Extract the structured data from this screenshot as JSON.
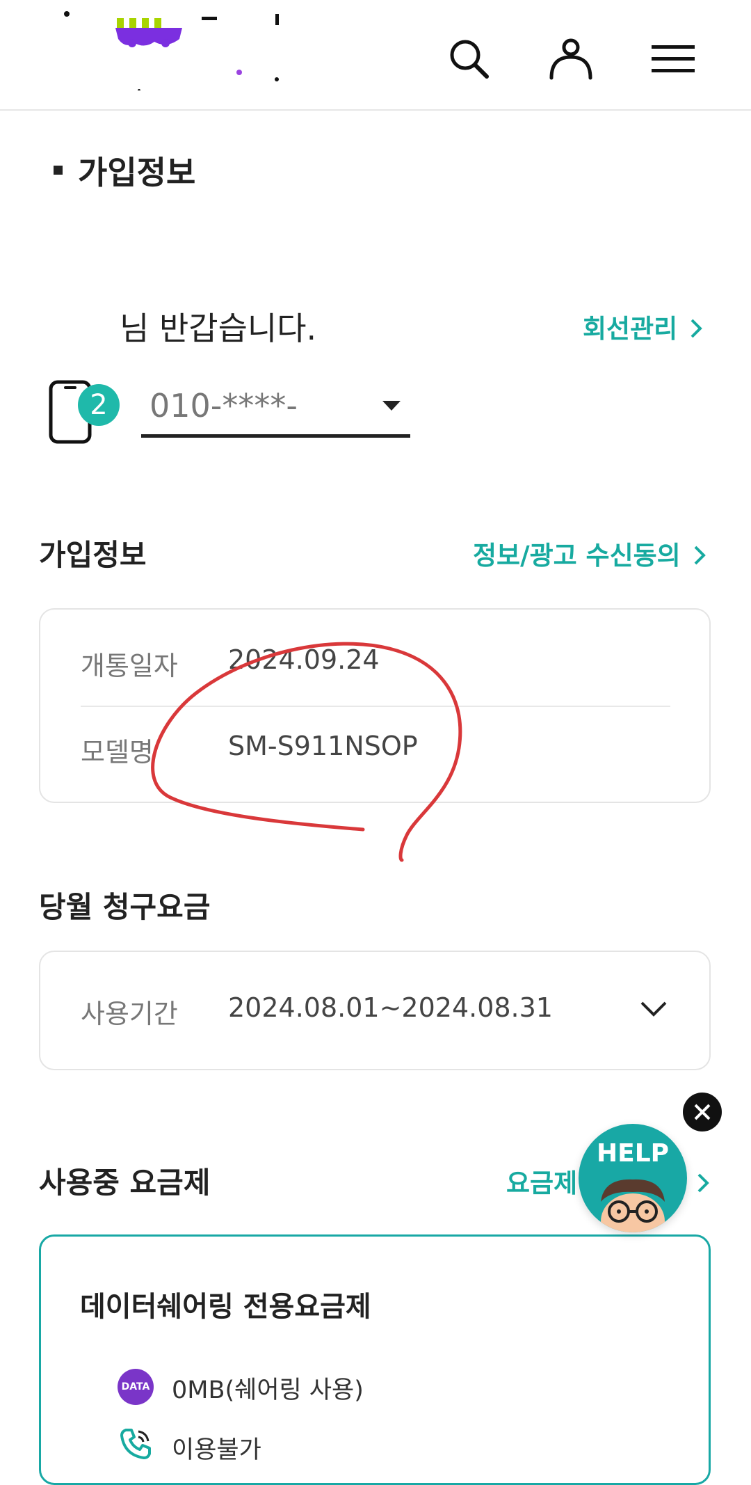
{
  "header": {
    "logo_name": "brand-logo",
    "icons": [
      "search-icon",
      "user-icon",
      "menu-icon"
    ]
  },
  "page": {
    "title": "가입정보"
  },
  "greeting": {
    "text": "님 반갑습니다.",
    "line_manage_label": "회선관리"
  },
  "phone_selector": {
    "count_badge": "2",
    "selected_number": "010-****-"
  },
  "subscription_info": {
    "title": "가입정보",
    "consent_link": "정보/광고 수신동의",
    "rows": [
      {
        "label": "개통일자",
        "value": "2024.09.24"
      },
      {
        "label": "모델명",
        "value": "SM-S911NSOP"
      }
    ]
  },
  "billing": {
    "title": "당월 청구요금",
    "period_label": "사용기간",
    "period_value": "2024.08.01~2024.08.31"
  },
  "plan": {
    "title": "사용중 요금제",
    "link_label": "요금제",
    "plan_name": "데이터쉐어링 전용요금제",
    "data_badge": "DATA",
    "data_value": "0MB(쉐어링 사용)",
    "voice_value": "이용불가"
  },
  "help": {
    "label": "HELP"
  },
  "colors": {
    "accent": "#17aaa0",
    "annotation": "#d9383a",
    "data_badge": "#7a35c8"
  }
}
